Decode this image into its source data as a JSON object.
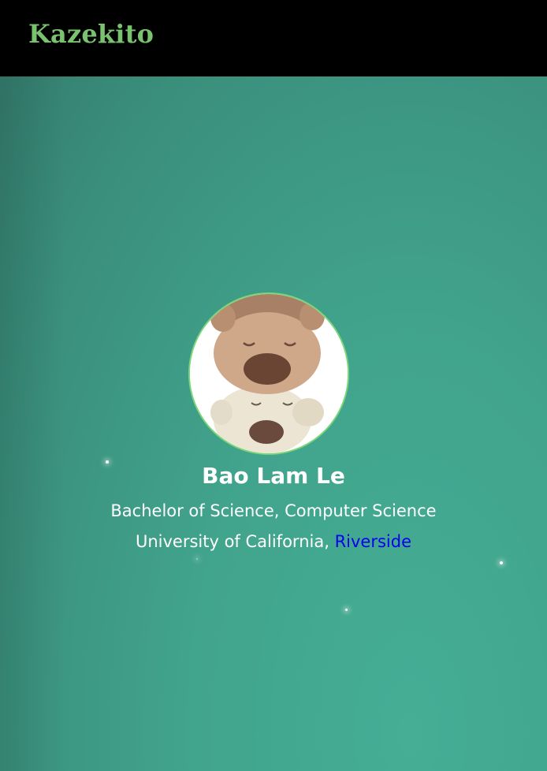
{
  "header": {
    "brand": "Kazekito"
  },
  "profile": {
    "avatar_alt": "avatar",
    "name": "Bao Lam Le",
    "degree": "Bachelor of Science, Computer Science",
    "school_prefix": "University of California, ",
    "school_link": "Riverside"
  },
  "colors": {
    "brand": "#79c36e",
    "avatar_border": "#7bd67a",
    "link": "#0000ee",
    "background": "#41a38c"
  }
}
